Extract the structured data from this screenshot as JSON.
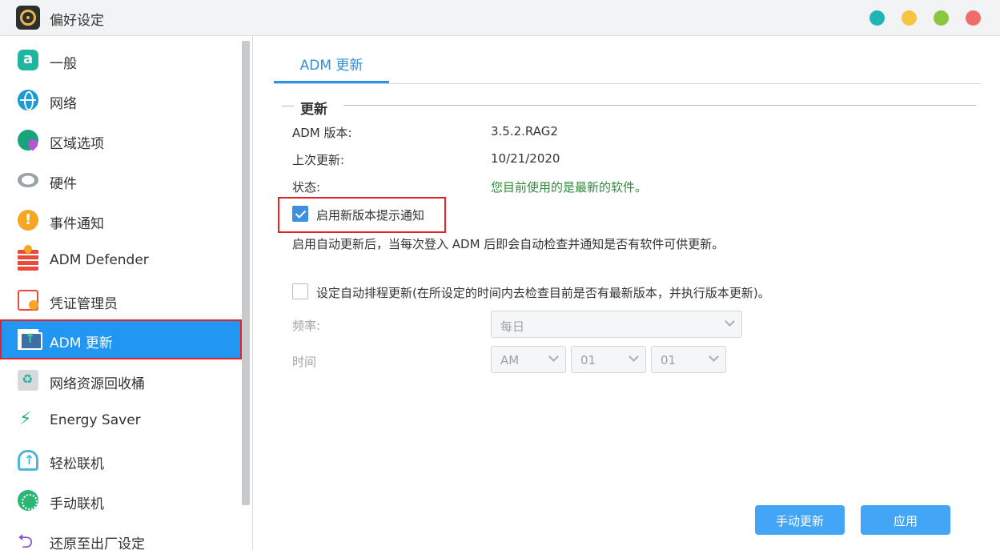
{
  "window": {
    "title": "偏好设定"
  },
  "sidebar": {
    "items": [
      {
        "label": "一般",
        "icon": "general-icon"
      },
      {
        "label": "网络",
        "icon": "globe-icon"
      },
      {
        "label": "区域选项",
        "icon": "region-icon"
      },
      {
        "label": "硬件",
        "icon": "hardware-icon"
      },
      {
        "label": "事件通知",
        "icon": "alert-icon"
      },
      {
        "label": "ADM Defender",
        "icon": "firewall-icon"
      },
      {
        "label": "凭证管理员",
        "icon": "certificate-icon"
      },
      {
        "label": "ADM 更新",
        "icon": "update-icon",
        "active": true
      },
      {
        "label": "网络资源回收桶",
        "icon": "recycle-bin-icon"
      },
      {
        "label": "Energy Saver",
        "icon": "energy-icon"
      },
      {
        "label": "轻松联机",
        "icon": "cloud-upload-icon"
      },
      {
        "label": "手动联机",
        "icon": "manual-connect-icon"
      },
      {
        "label": "还原至出厂设定",
        "icon": "reset-icon"
      }
    ]
  },
  "main": {
    "tab": "ADM 更新",
    "section_title": "更新",
    "info": [
      {
        "label": "ADM 版本:",
        "value": "3.5.2.RAG2"
      },
      {
        "label": "上次更新:",
        "value": "10/21/2020"
      },
      {
        "label": "状态:",
        "value": "您目前使用的是最新的软件。"
      }
    ],
    "notify_checkbox": {
      "label": "启用新版本提示通知",
      "checked": true
    },
    "description": "启用自动更新后，当每次登入 ADM 后即会自动检查并通知是否有软件可供更新。",
    "schedule_checkbox": {
      "label": "设定自动排程更新(在所设定的时间内去检查目前是否有最新版本，并执行版本更新)。",
      "checked": false
    },
    "frequency": {
      "label": "频率:",
      "value": "每日"
    },
    "time": {
      "label": "时间",
      "ampm": "AM",
      "hour": "01",
      "minute": "01"
    },
    "buttons": {
      "manual_update": "手动更新",
      "apply": "应用"
    }
  },
  "colors": {
    "accent": "#2196f3",
    "highlight_border": "#e0242a",
    "status_ok": "#2e8b3a",
    "button": "#42a5f5"
  }
}
